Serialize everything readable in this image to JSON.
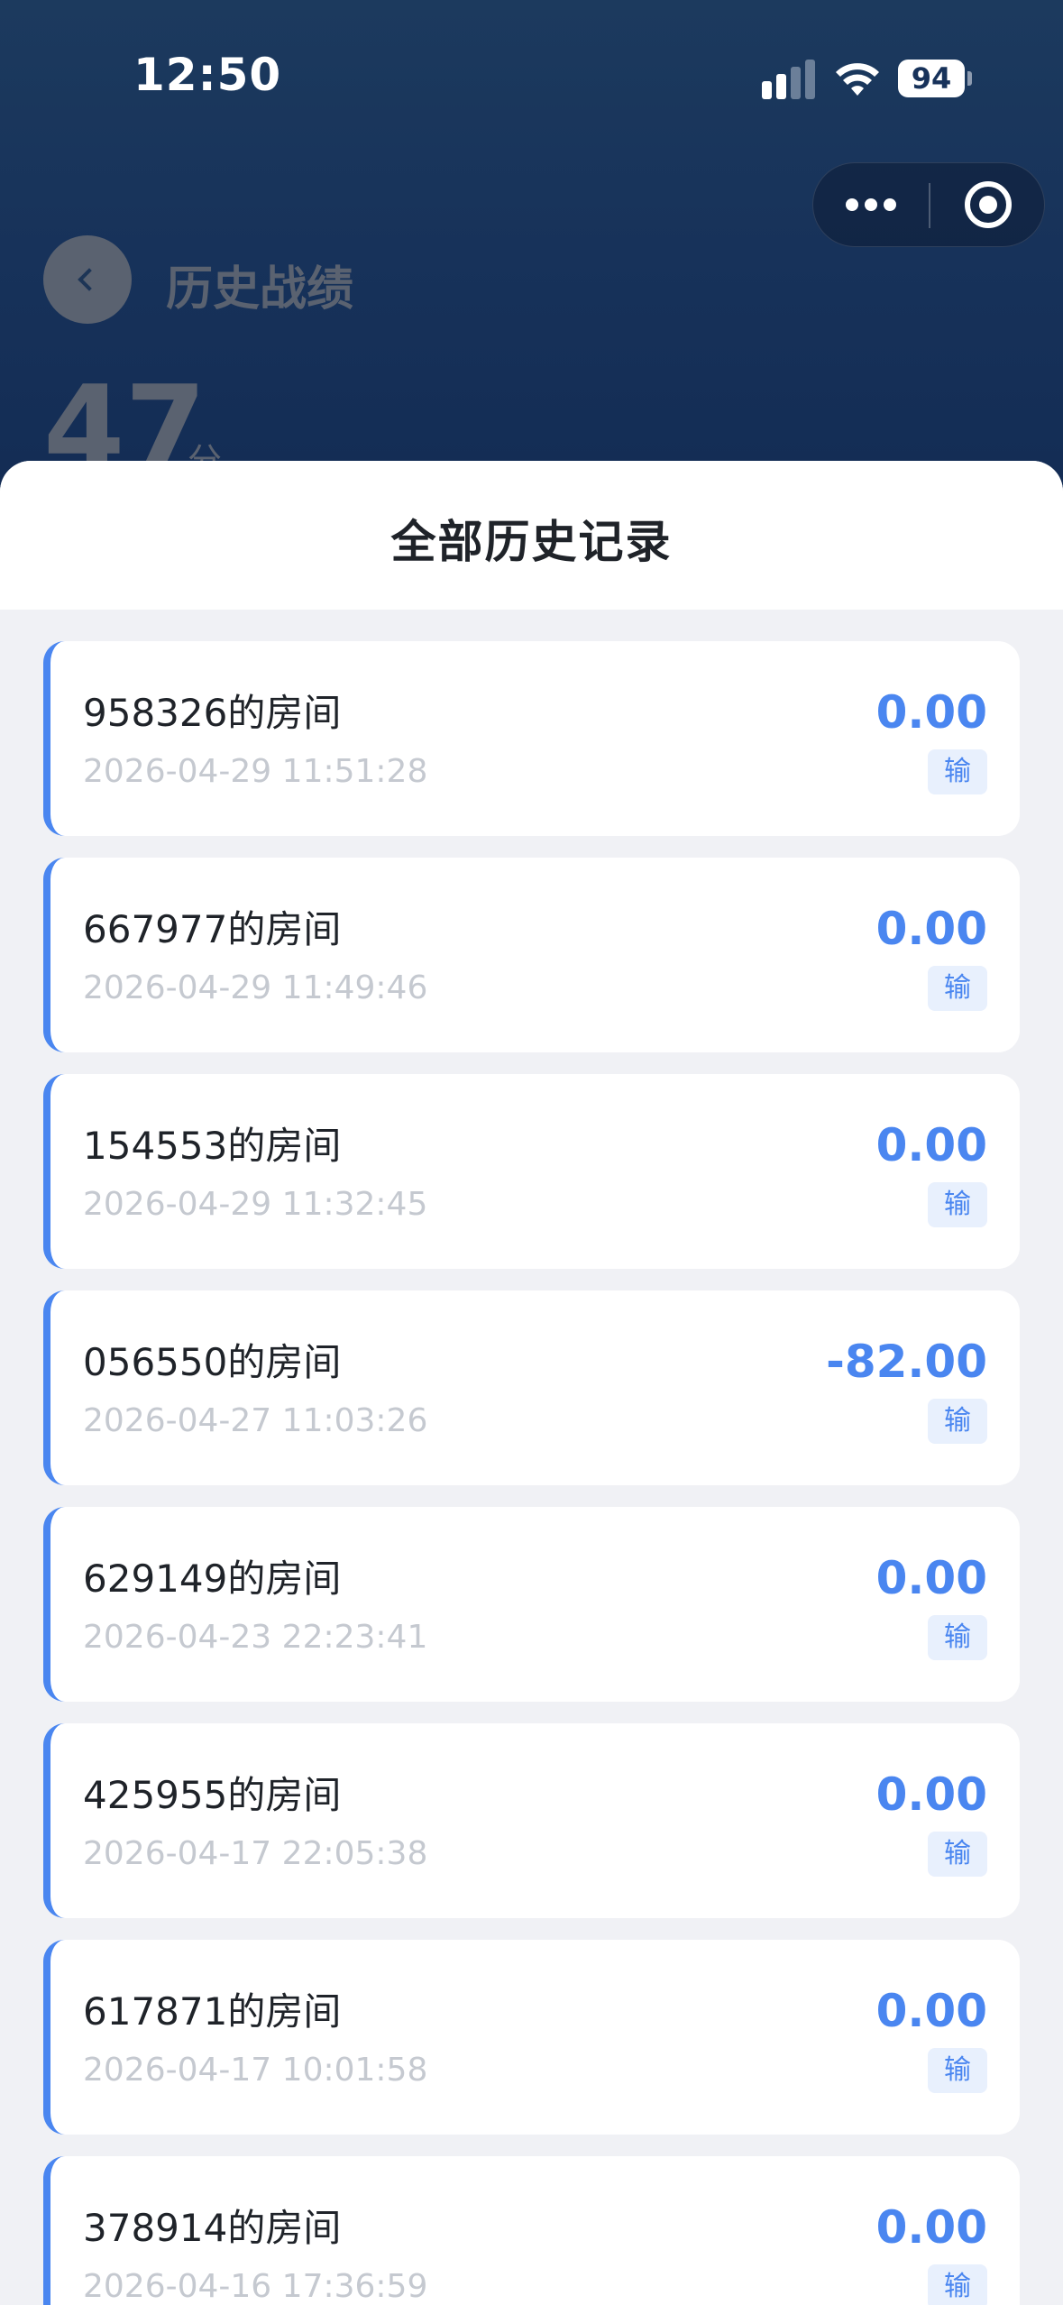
{
  "status_bar": {
    "time": "12:50",
    "battery": "94"
  },
  "colors": {
    "accent": "#4a86f0",
    "header_bg": "#17325a",
    "badge_bg": "#e8f0fd",
    "time_text": "#c5c9d0"
  },
  "icons": {
    "back": "chevron-left-icon",
    "more": "more-dots-icon",
    "close": "target-close-icon",
    "signal": "signal-icon",
    "wifi": "wifi-icon",
    "battery": "battery-icon"
  },
  "background_page": {
    "title": "历史战绩",
    "score_value": "47",
    "score_unit": "分"
  },
  "sheet": {
    "title": "全部历史记录",
    "records": [
      {
        "room": "958326的房间",
        "time": "2026-04-29 11:51:28",
        "score": "0.00",
        "result": "输"
      },
      {
        "room": "667977的房间",
        "time": "2026-04-29 11:49:46",
        "score": "0.00",
        "result": "输"
      },
      {
        "room": "154553的房间",
        "time": "2026-04-29 11:32:45",
        "score": "0.00",
        "result": "输"
      },
      {
        "room": "056550的房间",
        "time": "2026-04-27 11:03:26",
        "score": "-82.00",
        "result": "输"
      },
      {
        "room": "629149的房间",
        "time": "2026-04-23 22:23:41",
        "score": "0.00",
        "result": "输"
      },
      {
        "room": "425955的房间",
        "time": "2026-04-17 22:05:38",
        "score": "0.00",
        "result": "输"
      },
      {
        "room": "617871的房间",
        "time": "2026-04-17 10:01:58",
        "score": "0.00",
        "result": "输"
      },
      {
        "room": "378914的房间",
        "time": "2026-04-16 17:36:59",
        "score": "0.00",
        "result": "输"
      }
    ]
  }
}
